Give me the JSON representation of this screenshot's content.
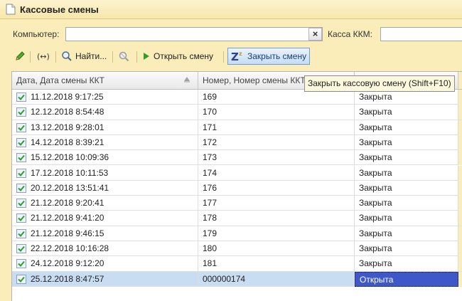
{
  "window": {
    "title": "Кассовые смены"
  },
  "filters": {
    "computer_label": "Компьютер:",
    "computer_value": "",
    "clear_label": "×",
    "register_label": "Касса ККМ:",
    "register_value": ""
  },
  "toolbar": {
    "find_label": "Найти...",
    "open_shift_label": "Открыть смену",
    "close_shift_label": "Закрыть смену",
    "tooltip": "Закрыть кассовую смену (Shift+F10)"
  },
  "table": {
    "columns": [
      "Дата, Дата смены ККТ",
      "Номер, Номер смены ККТ",
      "",
      ""
    ],
    "rows": [
      {
        "date": "11.12.2018 9:17:25",
        "number": "169",
        "status": "Закрыта"
      },
      {
        "date": "12.12.2018 8:54:48",
        "number": "170",
        "status": "Закрыта"
      },
      {
        "date": "13.12.2018 9:28:01",
        "number": "171",
        "status": "Закрыта"
      },
      {
        "date": "14.12.2018 8:39:21",
        "number": "172",
        "status": "Закрыта"
      },
      {
        "date": "15.12.2018 10:09:36",
        "number": "173",
        "status": "Закрыта"
      },
      {
        "date": "17.12.2018 10:11:53",
        "number": "174",
        "status": "Закрыта"
      },
      {
        "date": "20.12.2018 13:51:41",
        "number": "176",
        "status": "Закрыта"
      },
      {
        "date": "21.12.2018 9:20:41",
        "number": "177",
        "status": "Закрыта"
      },
      {
        "date": "21.12.2018 9:41:20",
        "number": "178",
        "status": "Закрыта"
      },
      {
        "date": "21.12.2018 9:46:15",
        "number": "179",
        "status": "Закрыта"
      },
      {
        "date": "22.12.2018 10:16:28",
        "number": "180",
        "status": "Закрыта"
      },
      {
        "date": "24.12.2018 9:12:20",
        "number": "181",
        "status": "Закрыта"
      },
      {
        "date": "25.12.2018 8:47:57",
        "number": "000000174",
        "status": "Открыта",
        "selected": true
      }
    ]
  },
  "colors": {
    "background": "#fbedb9",
    "selection": "#c8dcf2",
    "selected_cell": "#3f58c9"
  }
}
